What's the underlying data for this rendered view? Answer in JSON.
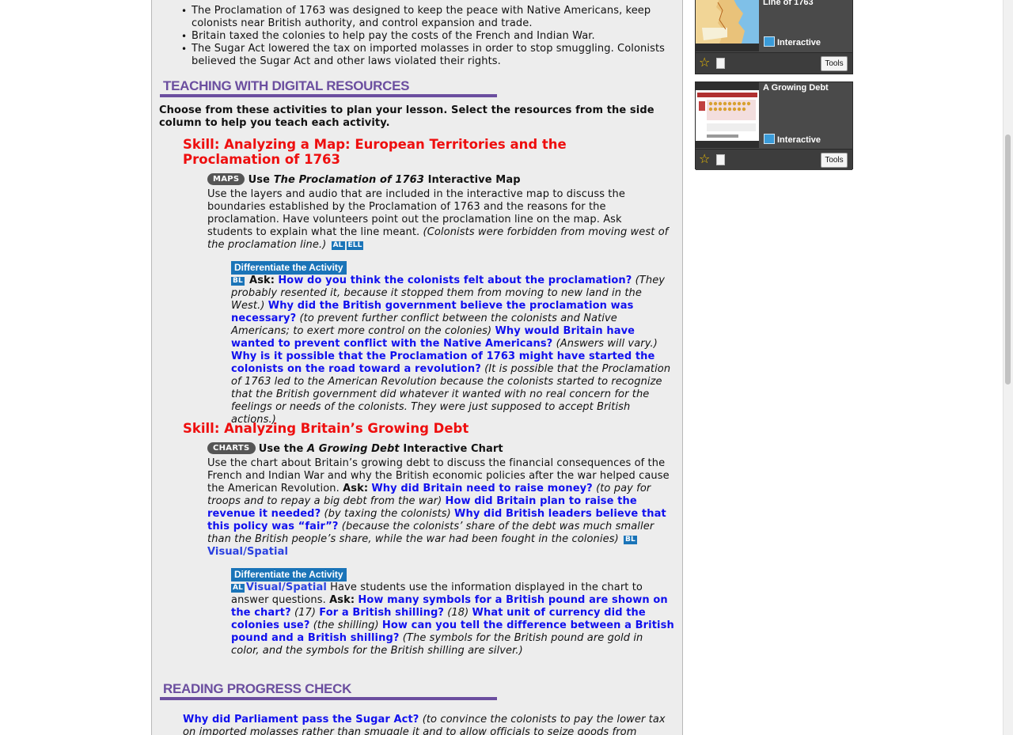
{
  "bullets": [
    "The Proclamation of 1763 was designed to keep the peace with Native Americans, keep colonists near British authority, and control expansion and trade.",
    "Britain taxed the colonies to help pay the costs of the French and Indian War.",
    "The Sugar Act lowered the tax on imported molasses in order to stop smuggling. Colonists believed the Sugar Act and other laws violated their rights."
  ],
  "teaching": {
    "title": "TEACHING WITH DIGITAL RESOURCES",
    "intro": "Choose from these activities to plan your lesson. Select the resources from the side column to help you teach each activity."
  },
  "skill1": {
    "title": "Skill: Analyzing a Map: European Territories and the Proclamation of 1763",
    "tag": "MAPS",
    "heading_pre": "Use ",
    "heading_italic": "The Proclamation of 1763",
    "heading_post": " Interactive Map",
    "body": "Use the layers and audio that are included in the interactive map to discuss the boundaries established by the Proclamation of 1763 and the reasons for the proclamation. Have volunteers point out the proclamation line on the map. Ask students to explain what the line meant.",
    "answer": "(Colonists were forbidden from moving west of the proclamation line.)",
    "badge_al": "AL",
    "badge_ell": "ELL",
    "diff_label": "Differentiate the Activity",
    "diff_badge": "BL",
    "ask": "Ask:",
    "q1": "How do you think the colonists felt about the proclamation?",
    "a1": "(They probably resented it, because it stopped them from moving to new land in the West.)",
    "q2": "Why did the British government believe the proclamation was necessary?",
    "a2": "(to prevent further conflict between the colonists and Native Americans; to exert more control on the colonies)",
    "q3": "Why would Britain have wanted to prevent conflict with the Native Americans?",
    "a3": "(Answers will vary.)",
    "q4": "Why is it possible that the Proclamation of 1763 might have started the colonists on the road toward a revolution?",
    "a4": "(It is possible that the Proclamation of 1763 led to the American Revolution because the colonists started to recognize that the British government did whatever it wanted with no real concern for the feelings or needs of the colonists. They were just supposed to accept British actions.)"
  },
  "skill2": {
    "title": "Skill: Analyzing Britain’s Growing Debt",
    "tag": "CHARTS",
    "heading_pre": "Use the ",
    "heading_italic": "A Growing Debt",
    "heading_post": " Interactive Chart",
    "body": "Use the chart about Britain’s growing debt to discuss the financial consequences of the French and Indian War and why the British economic policies after the war helped cause the American Revolution.",
    "ask": "Ask:",
    "q1": "Why did Britain need to raise money?",
    "a1": "(to pay for troops and to repay a big debt from the war)",
    "q2": "How did Britain plan to raise the revenue it needed?",
    "a2": "(by taxing the colonists)",
    "q3": "Why did British leaders believe that this policy was “fair”?",
    "a3": "(because the colonists’ share of the debt was much smaller than the British people’s share, while the war had been fought in the colonies)",
    "badge_bl": "BL",
    "link1": "Visual/Spatial",
    "diff_label": "Differentiate the Activity",
    "diff_badge": "AL",
    "link2": "Visual/Spatial",
    "diff_body": "Have students use the information displayed in the chart to answer questions.",
    "dq1": "How many symbols for a British pound are shown on the chart?",
    "da1": "(17)",
    "dq2": "For a British shilling?",
    "da2": "(18)",
    "dq3": "What unit of currency did the colonies use?",
    "da3": "(the shilling)",
    "dq4": "How can you tell the difference between a British pound and a British shilling?",
    "da4": "(The symbols for the British pound are gold in color, and the symbols for the British shilling are silver.)"
  },
  "reading": {
    "title": "READING PROGRESS CHECK",
    "q": "Why did Parliament pass the Sugar Act?",
    "a": "(to convince the colonists to pay the lower tax on imported molasses rather than smuggle it and to allow officials to seize goods from"
  },
  "sidebar": {
    "cards": [
      {
        "title": "Line of 1763",
        "type": "Interactive",
        "tools": "Tools"
      },
      {
        "title": "A Growing Debt",
        "type": "Interactive",
        "tools": "Tools"
      }
    ]
  },
  "colors": {
    "section_title": "#6b4e9f",
    "skill": "#ee0e0e",
    "question": "#1010ee",
    "badge": "#1a74b8"
  }
}
